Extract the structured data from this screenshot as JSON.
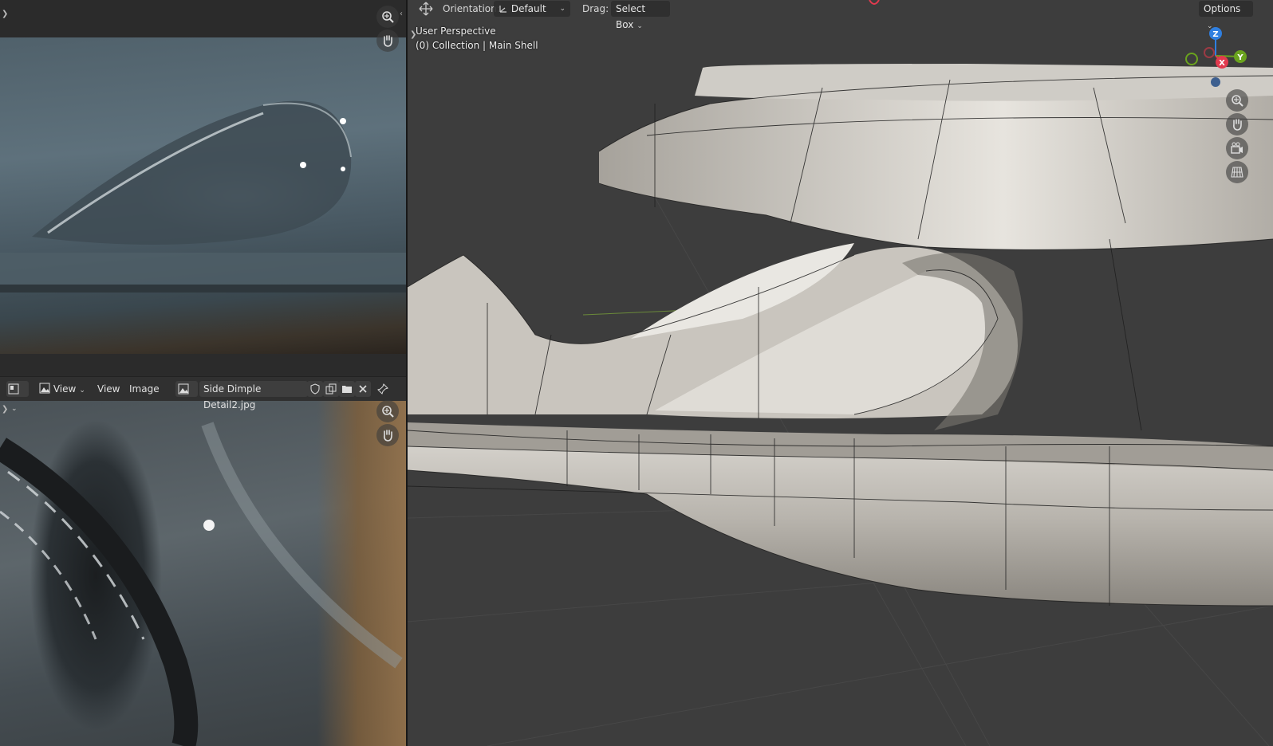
{
  "image_editor": {
    "header": {
      "view_menu_1": "View",
      "view_menu_2": "View",
      "image_menu": "Image",
      "image_name": "Side Dimple Detail2.jpg"
    }
  },
  "viewport": {
    "header": {
      "orientation_label": "Orientation:",
      "orientation_value": "Default",
      "drag_label": "Drag:",
      "drag_value": "Select Box",
      "options_label": "Options"
    },
    "overlay": {
      "perspective": "User Perspective",
      "collection_info": "(0) Collection | Main Shell"
    },
    "gizmo": {
      "z_label": "Z",
      "y_label": "Y",
      "x_label": "X",
      "z_color": "#2f7fe0",
      "y_color": "#6aa31e",
      "x_color": "#e23a4e"
    }
  },
  "icons": [
    "zoom-icon",
    "hand-pan-icon",
    "camera-icon",
    "grid-ortho-icon",
    "move-gizmo-icon",
    "image-icon",
    "shield-icon",
    "duplicate-icon",
    "folder-icon",
    "close-icon",
    "pin-icon"
  ]
}
